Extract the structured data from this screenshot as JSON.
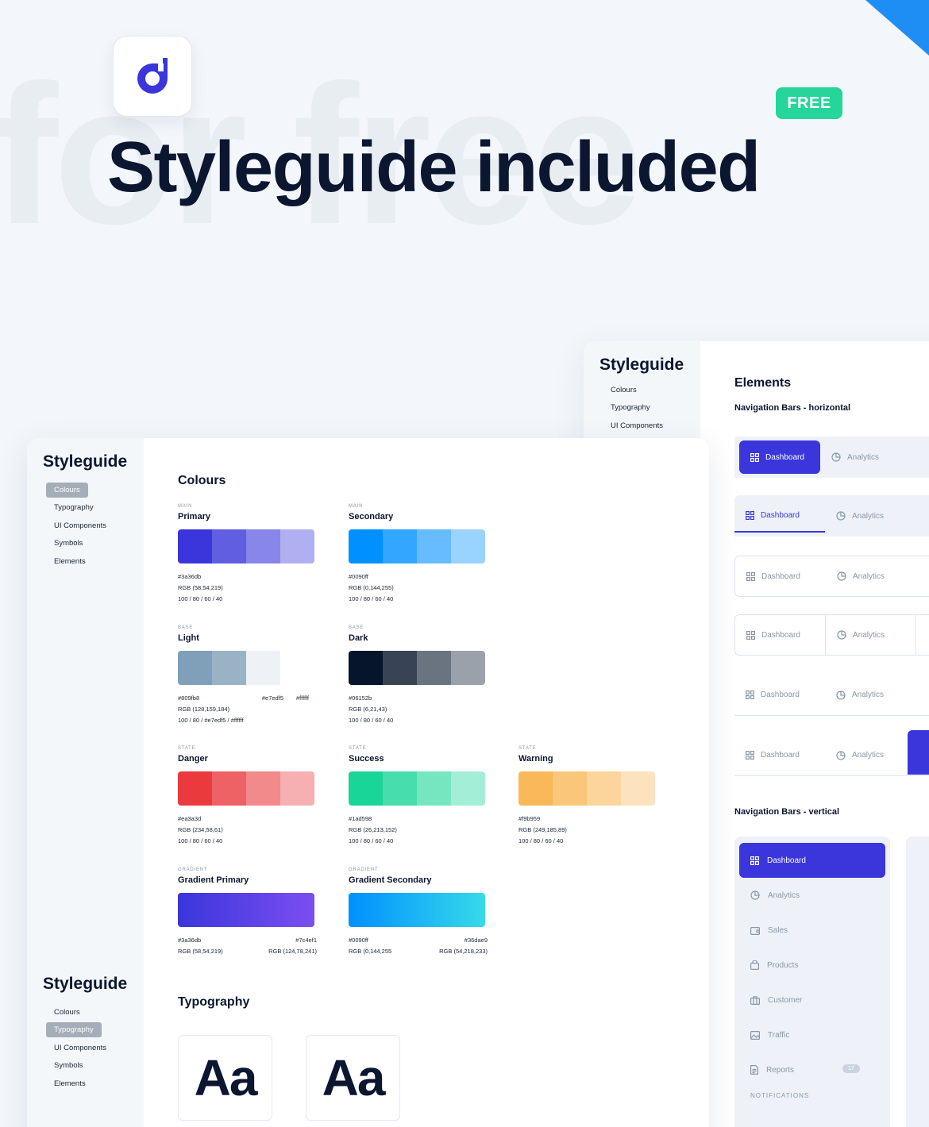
{
  "hero": {
    "bg_word": "for free",
    "badge": "FREE",
    "headline": "Styleguide included"
  },
  "back_panel": {
    "sidebar_title": "Styleguide",
    "sidebar_items": [
      "Colours",
      "Typography",
      "UI Components"
    ],
    "title": "Elements",
    "section_horizontal": "Navigation Bars - horizontal",
    "nav_dashboard": "Dashboard",
    "nav_analytics": "Analytics",
    "section_vertical": "Navigation Bars - vertical",
    "vertical_items": [
      "Dashboard",
      "Analytics",
      "Sales",
      "Products",
      "Customer",
      "Traffic",
      "Reports"
    ],
    "reports_badge": "17",
    "notifications_label": "NOTIFICATIONS"
  },
  "front_panel": {
    "sidebar_title": "Styleguide",
    "sidebar_items": [
      "Colours",
      "Typography",
      "UI Components",
      "Symbols",
      "Elements"
    ],
    "sidebar_title_2": "Styleguide",
    "sidebar_items_2": [
      "Colours",
      "Typography",
      "UI Components",
      "Symbols",
      "Elements"
    ],
    "colours_title": "Colours",
    "typography_title": "Typography",
    "type_sample": "Aa",
    "colors": {
      "primary": {
        "tag": "MAIN",
        "name": "Primary",
        "hex": "#3a36db",
        "rgb": "RGB (58,54,219)",
        "opacity": "100 / 80 / 60 / 40",
        "swatches": [
          "#3a36db",
          "#615ee2",
          "#8986e9",
          "#b0aff1"
        ]
      },
      "secondary": {
        "tag": "MAIN",
        "name": "Secondary",
        "hex": "#0090ff",
        "rgb": "RGB (0,144,255)",
        "opacity": "100 / 80 / 60 / 40",
        "swatches": [
          "#0090ff",
          "#33a6ff",
          "#66bcff",
          "#99d3ff"
        ]
      },
      "light": {
        "tag": "BASE",
        "name": "Light",
        "hex": "#809fb8",
        "hex2": "#e7edf5",
        "hex3": "#ffffff",
        "rgb": "RGB (128,159,184)",
        "opacity": "100 / 80 / #e7edf5 / #ffffff",
        "swatches": [
          "#809fb8",
          "#99b2c6",
          "#eef2f7",
          "#ffffff"
        ]
      },
      "dark": {
        "tag": "BASE",
        "name": "Dark",
        "hex": "#06152b",
        "rgb": "RGB (6,21,43)",
        "opacity": "100 / 80 / 60 / 40",
        "swatches": [
          "#06152b",
          "#384455",
          "#6a7380",
          "#9ba1aa"
        ]
      },
      "danger": {
        "tag": "STATE",
        "name": "Danger",
        "hex": "#ea3a3d",
        "rgb": "RGB (234,58,61)",
        "opacity": "100 / 80 / 60 / 40",
        "swatches": [
          "#ea3a3d",
          "#ee6164",
          "#f2898b",
          "#f7b0b1"
        ]
      },
      "success": {
        "tag": "STATE",
        "name": "Success",
        "hex": "#1ad598",
        "rgb": "RGB (26,213,152)",
        "opacity": "100 / 80 / 60 / 40",
        "swatches": [
          "#1ad598",
          "#48ddad",
          "#76e6c1",
          "#a3eed6"
        ]
      },
      "warning": {
        "tag": "STATE",
        "name": "Warning",
        "hex": "#f9b959",
        "rgb": "RGB (249,185,89)",
        "opacity": "100 / 80 / 60 / 40",
        "swatches": [
          "#f9b959",
          "#fac77a",
          "#fbd59b",
          "#fde3bd"
        ]
      },
      "gradient_primary": {
        "tag": "GRADIENT",
        "name": "Gradient Primary",
        "hex_from": "#3a36db",
        "hex_to": "#7c4ef1",
        "rgb_from": "RGB (58,54,219)",
        "rgb_to": "RGB (124,78,241)"
      },
      "gradient_secondary": {
        "tag": "GRADIENT",
        "name": "Gradient Secondary",
        "hex_from": "#0090ff",
        "hex_to": "#36dae9",
        "rgb_from": "RGB (0,144,255",
        "rgb_to": "RGB (54,218,233)"
      }
    }
  },
  "theme": {
    "accent": "#3a36db",
    "free_badge": "#26d59a",
    "corner": "#1e8ef5",
    "background": "#f3f7fb"
  }
}
